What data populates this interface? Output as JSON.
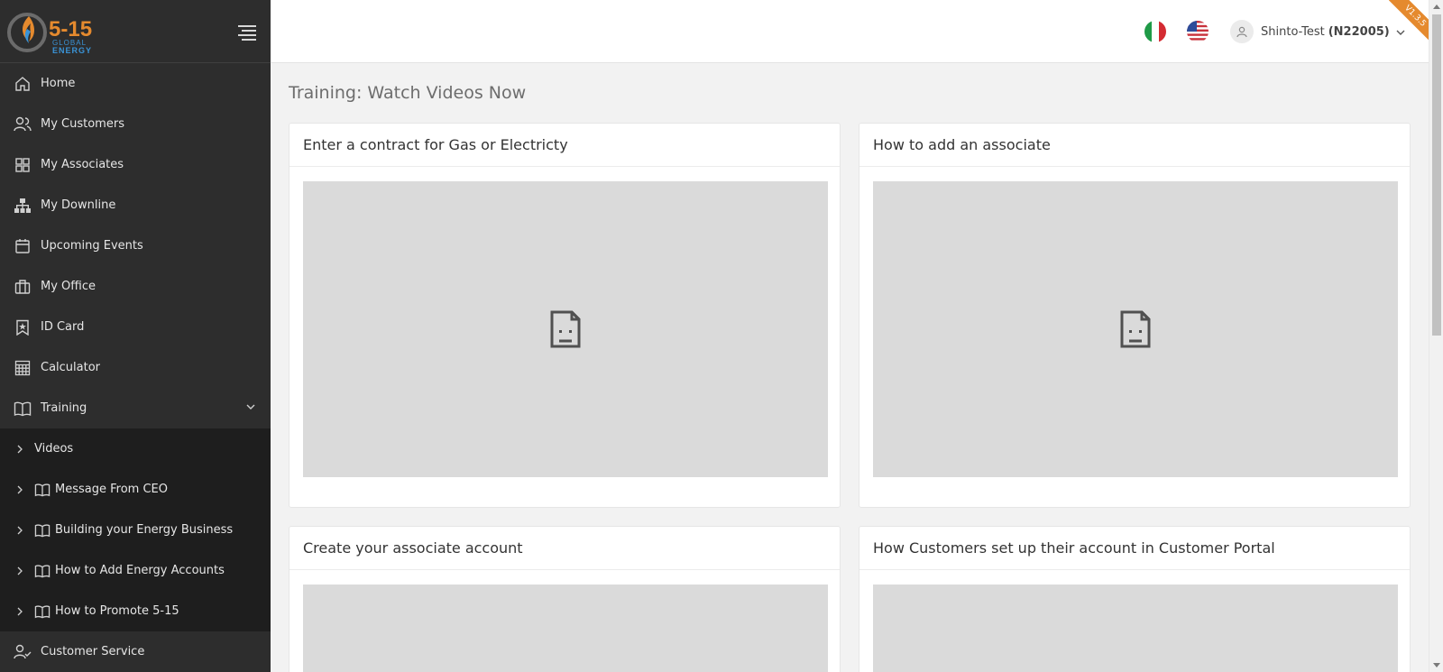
{
  "brand": {
    "logo_number": "5-15",
    "logo_line1": "GLOBAL",
    "logo_line2": "ENERGY",
    "orange": "#e58a2e",
    "blue": "#3a93d6"
  },
  "version": "V1.3.5",
  "topbar": {
    "user_name": "Shinto-Test",
    "user_code": "(N22005)",
    "flags": [
      "italy-flag",
      "us-flag"
    ]
  },
  "sidebar": {
    "items": [
      {
        "label": "Home",
        "icon": "home-icon"
      },
      {
        "label": "My Customers",
        "icon": "users-icon"
      },
      {
        "label": "My Associates",
        "icon": "grid-icon"
      },
      {
        "label": "My Downline",
        "icon": "hierarchy-icon"
      },
      {
        "label": "Upcoming Events",
        "icon": "calendar-icon"
      },
      {
        "label": "My Office",
        "icon": "briefcase-icon"
      },
      {
        "label": "ID Card",
        "icon": "bookmark-star-icon"
      },
      {
        "label": "Calculator",
        "icon": "calculator-icon"
      },
      {
        "label": "Training",
        "icon": "book-icon",
        "expanded": true
      }
    ],
    "training_sub": [
      {
        "label": "Videos"
      },
      {
        "label": "Message From CEO"
      },
      {
        "label": "Building your Energy Business"
      },
      {
        "label": "How to Add Energy Accounts"
      },
      {
        "label": "How to Promote 5-15"
      }
    ],
    "after": {
      "label": "Customer Service",
      "icon": "user-check-icon"
    }
  },
  "main": {
    "title": "Training: Watch Videos Now",
    "cards": [
      {
        "title": "Enter a contract for Gas or Electricty"
      },
      {
        "title": "How to add an associate"
      },
      {
        "title": "Create your associate account"
      },
      {
        "title": "How Customers set up their account in Customer Portal"
      }
    ]
  }
}
